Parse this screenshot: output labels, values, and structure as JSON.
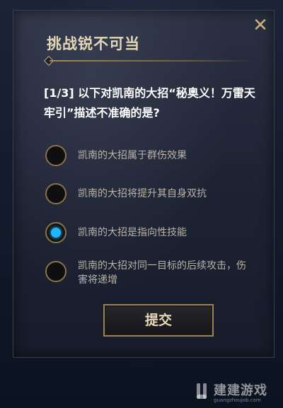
{
  "dialog": {
    "title": "挑战锐不可当",
    "question": "[1/3] 以下对凯南的大招“秘奥义！万雷天牢引”描述不准确的是?",
    "close_symbol": "✕"
  },
  "options": [
    {
      "label": "凯南的大招属于群伤效果",
      "selected": false
    },
    {
      "label": "凯南的大招将提升其自身双抗",
      "selected": false
    },
    {
      "label": "凯南的大招是指向性技能",
      "selected": true
    },
    {
      "label": "凯南的大招对同一目标的后续攻击，伤害将递增",
      "selected": false
    }
  ],
  "submit_label": "提交",
  "watermark": {
    "text": "建建游戏",
    "url": "guangzhoujob.com"
  },
  "colors": {
    "accent_gold": "#a78a55",
    "selected_blue": "#1fb6ff"
  }
}
